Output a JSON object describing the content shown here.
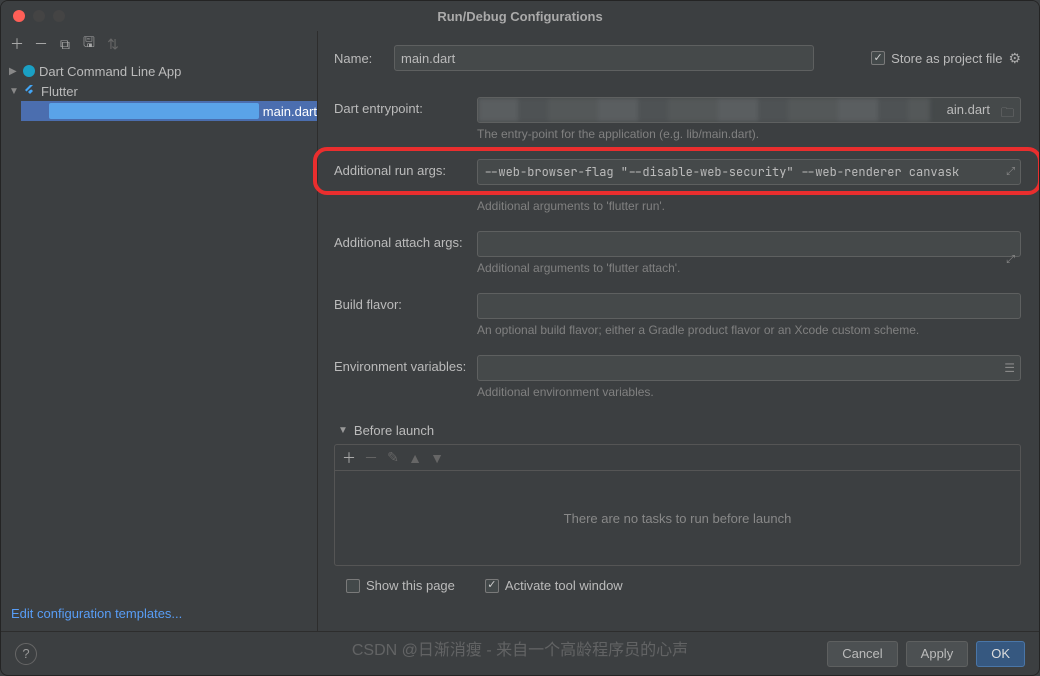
{
  "title": "Run/Debug Configurations",
  "tree": {
    "dart": "Dart Command Line App",
    "flutter": "Flutter",
    "main": "main.dart"
  },
  "editTemplates": "Edit configuration templates...",
  "nameLabel": "Name:",
  "nameValue": "main.dart",
  "storeLabel": "Store as project file",
  "entryLabel": "Dart entrypoint:",
  "entrySuffix": "ain.dart",
  "entryHint": "The entry-point for the application (e.g. lib/main.dart).",
  "runArgsLabel": "Additional run args:",
  "runArgsValue": "--web-browser-flag \"--disable-web-security\" --web-renderer canvask",
  "runArgsHint": "Additional arguments to 'flutter run'.",
  "attachLabel": "Additional attach args:",
  "attachValue": "",
  "attachHint": "Additional arguments to 'flutter attach'.",
  "flavorLabel": "Build flavor:",
  "flavorValue": "",
  "flavorHint": "An optional build flavor; either a Gradle product flavor or an Xcode custom scheme.",
  "envLabel": "Environment variables:",
  "envValue": "",
  "envHint": "Additional environment variables.",
  "beforeTitle": "Before launch",
  "beforeEmpty": "There are no tasks to run before launch",
  "showPage": "Show this page",
  "activateTool": "Activate tool window",
  "buttons": {
    "cancel": "Cancel",
    "apply": "Apply",
    "ok": "OK"
  },
  "watermark": "CSDN @日渐消瘦 - 来自一个高龄程序员的心声"
}
